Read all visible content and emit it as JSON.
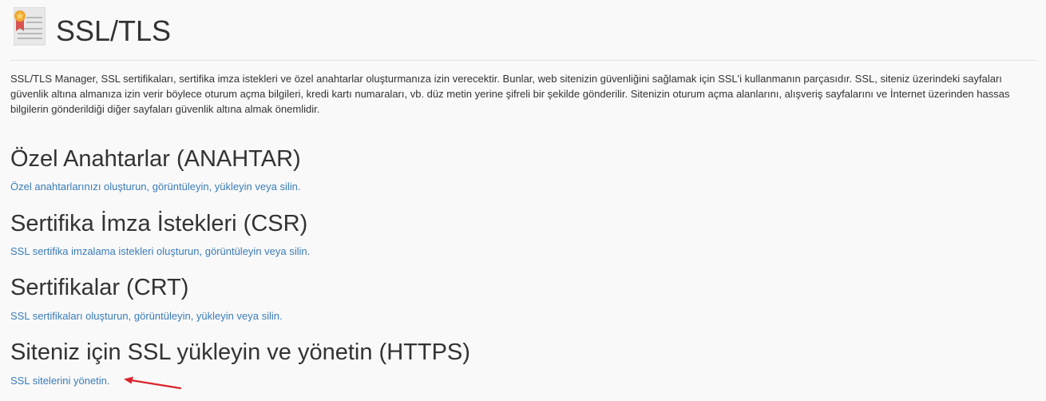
{
  "header": {
    "title": "SSL/TLS",
    "icon": "certificate-icon",
    "icon_colors": {
      "ribbon": "#d9534f",
      "star": "#f0a830",
      "paper": "#e8e8e8",
      "lines": "#b8b8b8"
    }
  },
  "description": "SSL/TLS Manager, SSL sertifikaları, sertifika imza istekleri ve özel anahtarlar oluşturmanıza izin verecektir. Bunlar, web sitenizin güvenliğini sağlamak için SSL'i kullanmanın parçasıdır. SSL, siteniz üzerindeki sayfaları güvenlik altına almanıza izin verir böylece oturum açma bilgileri, kredi kartı numaraları, vb. düz metin yerine şifreli bir şekilde gönderilir. Sitenizin oturum açma alanlarını, alışveriş sayfalarını ve İnternet üzerinden hassas bilgilerin gönderildiği diğer sayfaları güvenlik altına almak önemlidir.",
  "sections": [
    {
      "heading": "Özel Anahtarlar (ANAHTAR)",
      "link": "Özel anahtarlarınızı oluşturun, görüntüleyin, yükleyin veya silin."
    },
    {
      "heading": "Sertifika İmza İstekleri (CSR)",
      "link": "SSL sertifika imzalama istekleri oluşturun, görüntüleyin veya silin."
    },
    {
      "heading": "Sertifikalar (CRT)",
      "link": "SSL sertifikaları oluşturun, görüntüleyin, yükleyin veya silin."
    },
    {
      "heading": "Siteniz için SSL yükleyin ve yönetin (HTTPS)",
      "link": "SSL sitelerini yönetin."
    }
  ],
  "colors": {
    "link": "#3a7cb8",
    "text": "#333333",
    "annotation_arrow": "#d9262c"
  }
}
